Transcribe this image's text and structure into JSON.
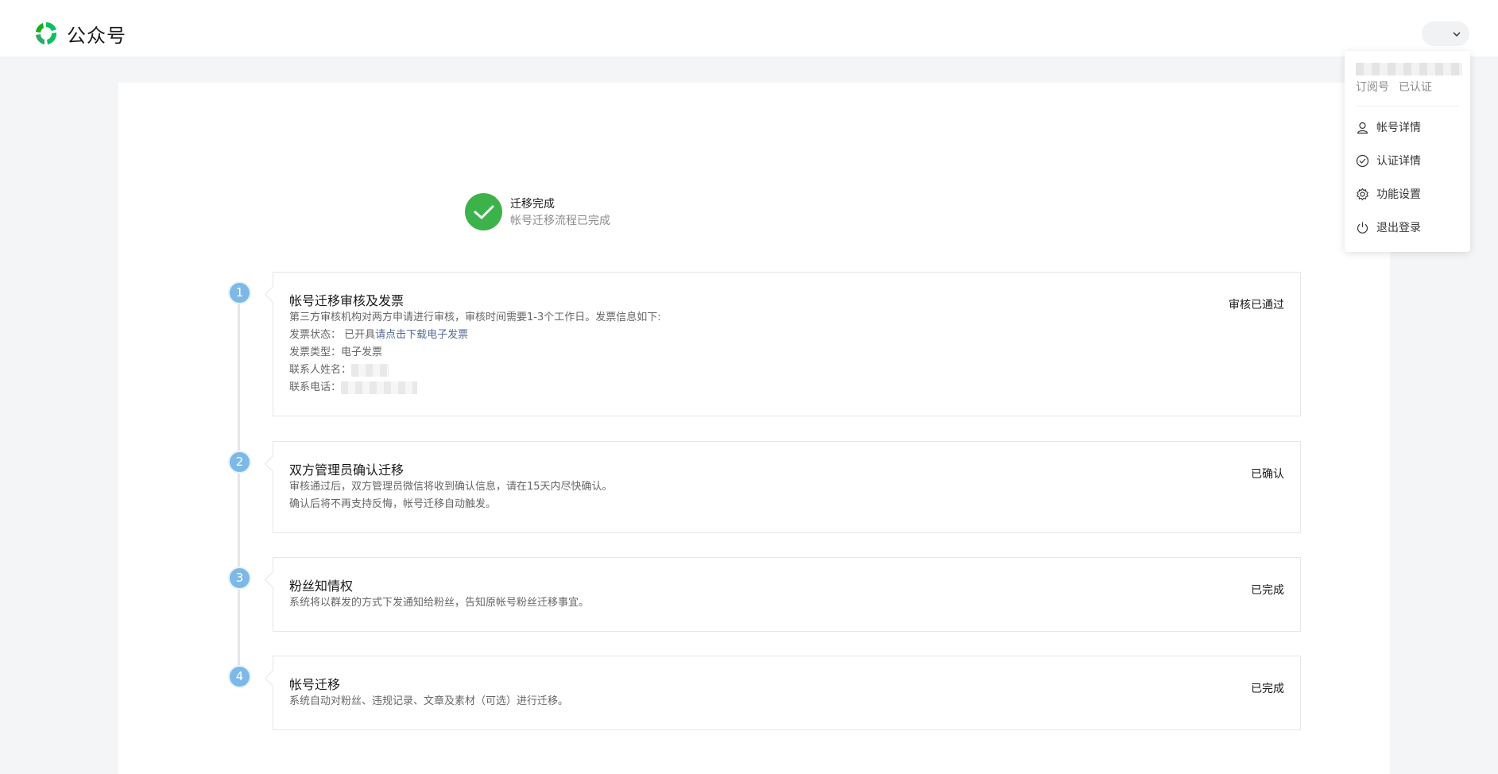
{
  "app": {
    "title": "公众号"
  },
  "header": {
    "account_menu_icon": "chevron-down-icon"
  },
  "completion": {
    "title": "迁移完成",
    "subtitle": "帐号迁移流程已完成"
  },
  "steps": [
    {
      "number": "1",
      "title": "帐号迁移审核及发票",
      "status": "审核已通过",
      "desc": "第三方审核机构对两方申请进行审核，审核时间需要1-3个工作日。发票信息如下:",
      "invoice_status_label": "发票状态：",
      "invoice_status_value": "已开具",
      "invoice_link": "请点击下载电子发票",
      "invoice_type_label": "发票类型：",
      "invoice_type_value": "电子发票",
      "contact_name_label": "联系人姓名：",
      "contact_phone_label": "联系电话："
    },
    {
      "number": "2",
      "title": "双方管理员确认迁移",
      "status": "已确认",
      "desc1": "审核通过后，双方管理员微信将收到确认信息，请在15天内尽快确认。",
      "desc2": "确认后将不再支持反悔，帐号迁移自动触发。"
    },
    {
      "number": "3",
      "title": "粉丝知情权",
      "status": "已完成",
      "desc1": "系统将以群发的方式下发通知给粉丝，告知原帐号粉丝迁移事宜。"
    },
    {
      "number": "4",
      "title": "帐号迁移",
      "status": "已完成",
      "desc1": "系统自动对粉丝、违规记录、文章及素材（可选）进行迁移。"
    }
  ],
  "dropdown": {
    "account_type": "订阅号",
    "verify_status": "已认证",
    "items": [
      {
        "label": "帐号详情",
        "icon": "user-icon"
      },
      {
        "label": "认证详情",
        "icon": "check-circle-icon"
      },
      {
        "label": "功能设置",
        "icon": "gear-icon"
      },
      {
        "label": "退出登录",
        "icon": "power-icon"
      }
    ]
  },
  "colors": {
    "brand_green": "#07c160",
    "success_green": "#3bb34a",
    "step_blue": "#7db8e6",
    "link_blue": "#576b95"
  }
}
